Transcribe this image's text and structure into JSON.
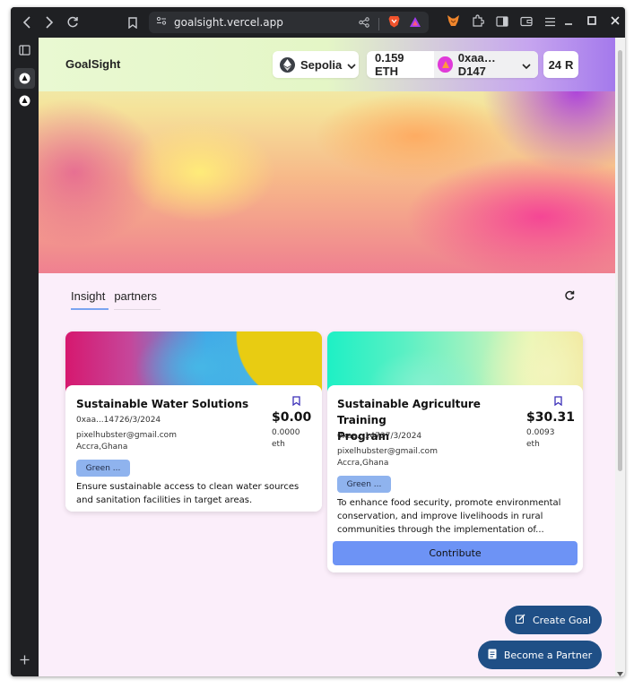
{
  "browser": {
    "url": "goalsight.vercel.app"
  },
  "header": {
    "brand": "GoalSight",
    "network": "Sepolia",
    "balance": "0.159 ETH",
    "address": "0xaa…D147",
    "points": "24",
    "points_unit": "R"
  },
  "tabs": [
    {
      "label": "Insight",
      "active": true
    },
    {
      "label": "partners",
      "active": false
    }
  ],
  "cards": [
    {
      "title": "Sustainable Water Solutions",
      "owner": "0xaa...147",
      "date": "26/3/2024",
      "email": "pixelhubster@gmail.com",
      "location": "Accra,Ghana",
      "amount": "$0.00",
      "eth_amount": "0.0000",
      "eth_unit": "eth",
      "badge": "Green ...",
      "description": "Ensure sustainable access to clean water sources and sanitation facilities in target areas."
    },
    {
      "title_line1": "Sustainable Agriculture Training",
      "title_line2": "Program",
      "owner": "0xaa...147",
      "date": "27/3/2024",
      "email": "pixelhubster@gmail.com",
      "location": "Accra,Ghana",
      "amount": "$30.31",
      "eth_amount": "0.0093",
      "eth_unit": "eth",
      "badge": "Green ...",
      "description": "To enhance food security, promote environmental conservation, and improve livelihoods in rural communities through the implementation of...",
      "button": "Contribute"
    }
  ],
  "actions": {
    "create_goal": "Create Goal",
    "become_partner": "Become a Partner"
  },
  "colors": {
    "accent": "#6d93f5",
    "fab": "#1f4f86",
    "badge": "#8fb3ee",
    "page_bg": "#fbeefa"
  }
}
